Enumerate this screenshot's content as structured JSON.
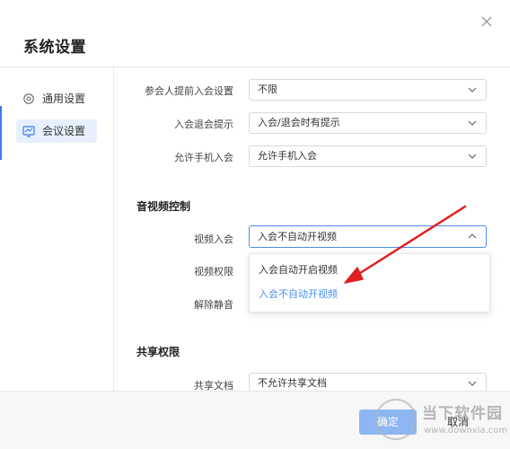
{
  "dialog": {
    "title": "系统设置",
    "close_icon": "close-icon"
  },
  "sidebar": {
    "items": [
      {
        "label": "通用设置",
        "icon": "gear-icon",
        "active": false
      },
      {
        "label": "会议设置",
        "icon": "meeting-icon",
        "active": true
      }
    ]
  },
  "settings": {
    "early_join": {
      "label": "参会人提前入会设置",
      "value": "不限"
    },
    "join_leave_tip": {
      "label": "入会退会提示",
      "value": "入会/退会时有提示"
    },
    "phone_join": {
      "label": "允许手机入会",
      "value": "允许手机入会"
    }
  },
  "av_section": {
    "title": "音视频控制",
    "video_join": {
      "label": "视频入会",
      "value": "入会不自动开视频"
    },
    "video_perm": {
      "label": "视频权限"
    },
    "unmute": {
      "label": "解除静音"
    }
  },
  "dropdown": {
    "options": [
      {
        "label": "入会自动开启视频",
        "selected": false
      },
      {
        "label": "入会不自动开视频",
        "selected": true
      }
    ]
  },
  "share_section": {
    "title": "共享权限",
    "share_doc": {
      "label": "共享文档",
      "value": "不允许共享文档"
    }
  },
  "footer": {
    "ok_label": "确定",
    "cancel_label": "取消"
  },
  "watermark": {
    "title": "当下软件园",
    "url": "www.downxia.com"
  },
  "colors": {
    "accent": "#4a8ff0",
    "active_bg": "#e6f0fd",
    "arrow": "#e02020",
    "ok_button": "#8db6f3"
  }
}
